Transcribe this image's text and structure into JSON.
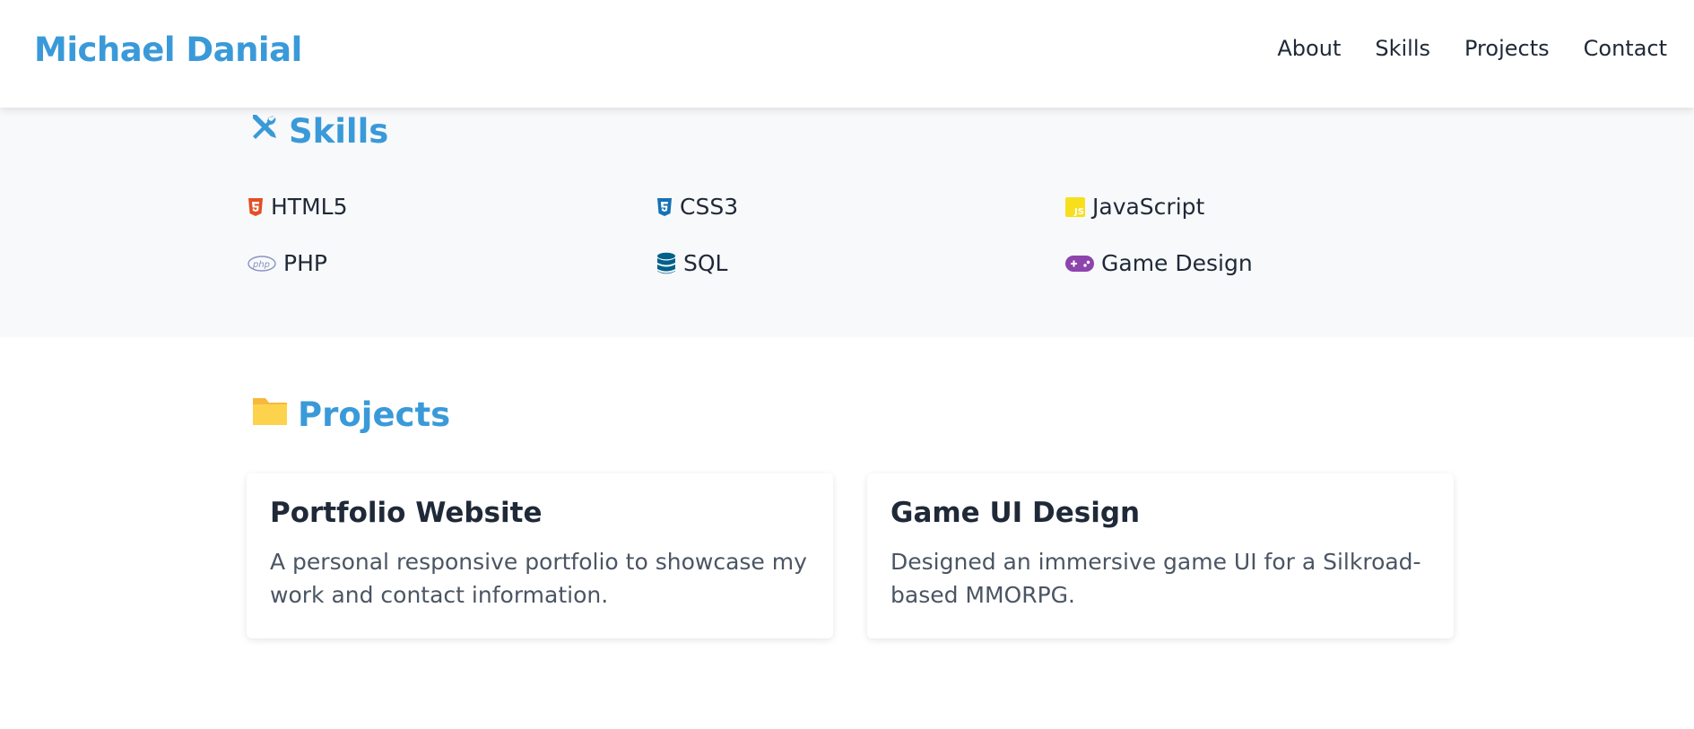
{
  "header": {
    "brand": "Michael Danial",
    "nav": [
      "About",
      "Skills",
      "Projects",
      "Contact"
    ]
  },
  "skills": {
    "title": "Skills",
    "icon": "tools-icon",
    "items": [
      {
        "label": "HTML5",
        "icon": "html5-icon",
        "color": "#e34f26"
      },
      {
        "label": "CSS3",
        "icon": "css3-icon",
        "color": "#1572b6"
      },
      {
        "label": "JavaScript",
        "icon": "javascript-icon",
        "color": "#f7df1e"
      },
      {
        "label": "PHP",
        "icon": "php-icon",
        "color": "#777bb4"
      },
      {
        "label": "SQL",
        "icon": "database-icon",
        "color": "#00618a"
      },
      {
        "label": "Game Design",
        "icon": "gamepad-icon",
        "color": "#8e44ad"
      }
    ]
  },
  "projects": {
    "title": "Projects",
    "icon": "folder-icon",
    "cards": [
      {
        "title": "Portfolio Website",
        "description": "A personal responsive portfolio to showcase my work and contact information."
      },
      {
        "title": "Game UI Design",
        "description": "Designed an immersive game UI for a Silkroad-based MMORPG."
      }
    ]
  },
  "colors": {
    "accent": "#3a9ad9",
    "text": "#1f2937",
    "muted": "#4b5563",
    "section_bg": "#f8f9fb"
  }
}
